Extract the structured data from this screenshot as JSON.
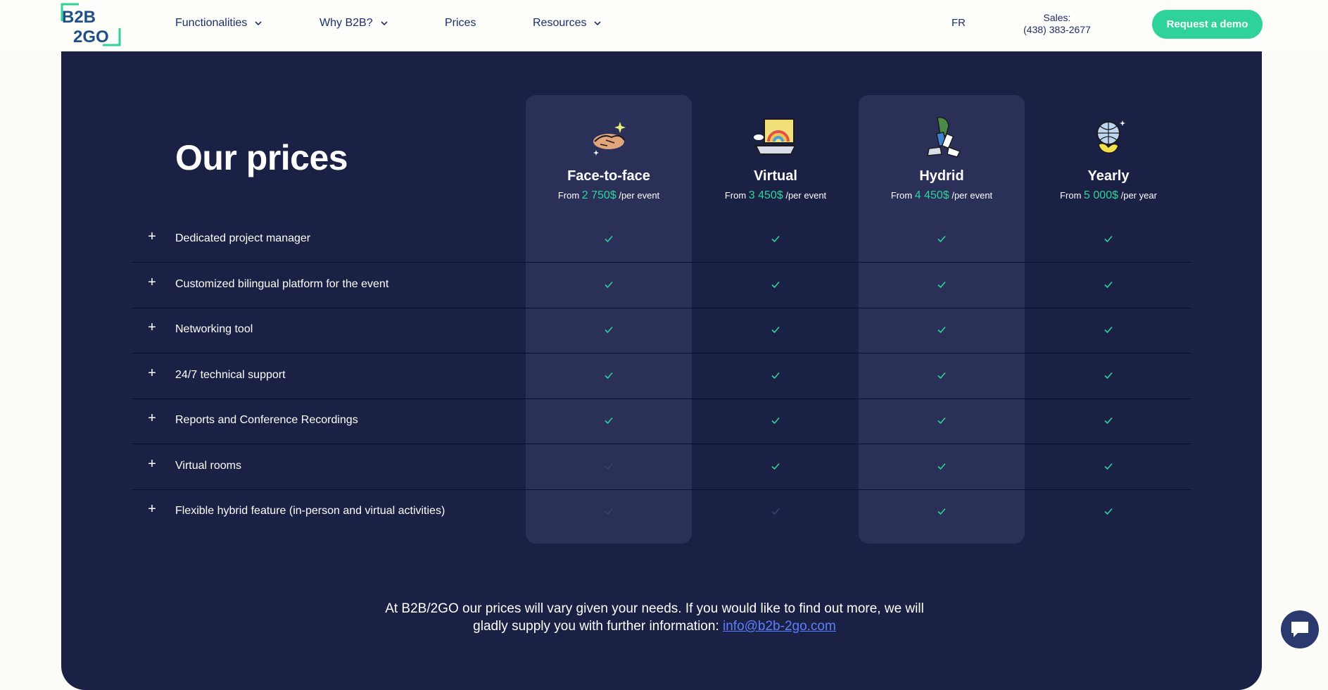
{
  "header": {
    "logo_line1": "B2B",
    "logo_line2": "2GO",
    "nav": [
      {
        "label": "Functionalities",
        "has_dropdown": true
      },
      {
        "label": "Why B2B?",
        "has_dropdown": true
      },
      {
        "label": "Prices",
        "has_dropdown": false
      },
      {
        "label": "Resources",
        "has_dropdown": true
      }
    ],
    "lang": "FR",
    "sales_label": "Sales:",
    "sales_phone": "(438) 383-2677",
    "demo_button": "Request a demo"
  },
  "main": {
    "title": "Our prices",
    "plans": [
      {
        "name": "Face-to-face",
        "from": "From",
        "amount": "2 750$",
        "per": "/per event",
        "icon": "handshake-icon",
        "highlighted": true
      },
      {
        "name": "Virtual",
        "from": "From",
        "amount": "3 450$",
        "per": "/per event",
        "icon": "laptop-rainbow-icon",
        "highlighted": false
      },
      {
        "name": "Hydrid",
        "from": "From",
        "amount": "4 450$",
        "per": "/per event",
        "icon": "legs-walking-icon",
        "highlighted": true
      },
      {
        "name": "Yearly",
        "from": "From",
        "amount": "5 000$",
        "per": "/per year",
        "icon": "globe-icon",
        "highlighted": false
      }
    ],
    "features": [
      {
        "label": "Dedicated project manager",
        "included": [
          true,
          true,
          true,
          true
        ]
      },
      {
        "label": "Customized bilingual platform for the event",
        "included": [
          true,
          true,
          true,
          true
        ]
      },
      {
        "label": "Networking tool",
        "included": [
          true,
          true,
          true,
          true
        ]
      },
      {
        "label": "24/7 technical support",
        "included": [
          true,
          true,
          true,
          true
        ]
      },
      {
        "label": "Reports and Conference Recordings",
        "included": [
          true,
          true,
          true,
          true
        ]
      },
      {
        "label": "Virtual rooms",
        "included": [
          false,
          true,
          true,
          true
        ]
      },
      {
        "label": "Flexible hybrid feature (in-person and virtual activities)",
        "included": [
          false,
          false,
          true,
          true
        ]
      }
    ],
    "footnote_text": "At B2B/2GO our prices will vary given your needs. If you would like to find out more, we will gladly supply you with further information:",
    "footnote_email": "info@b2b-2go.com"
  },
  "colors": {
    "accent": "#2fd39a",
    "panel": "#1b2145",
    "highlight_column": "#2a3058",
    "nav_text": "#1f2d6e",
    "link": "#5b7fff"
  }
}
